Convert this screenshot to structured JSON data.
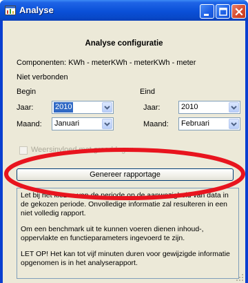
{
  "window": {
    "title": "Analyse"
  },
  "heading": "Analyse configuratie",
  "components_line": "Componenten: KWh - meterKWh - meterKWh - meter",
  "connection_status": "Niet verbonden",
  "begin": {
    "label": "Begin",
    "year_label": "Jaar:",
    "year_value": "2010",
    "month_label": "Maand:",
    "month_value": "Januari"
  },
  "end": {
    "label": "Eind",
    "year_label": "Jaar:",
    "year_value": "2010",
    "month_label": "Maand:",
    "month_value": "Februari"
  },
  "checkbox": {
    "label": "Weersinvloed met graaddagen",
    "checked": false,
    "enabled": false
  },
  "generate_button": "Genereer rapportage",
  "info": {
    "p1": "Let bij het kiezen van de periode op de aanwezigheid van data in de gekozen periode. Onvolledige informatie zal resulteren in een niet volledig rapport.",
    "p2": "Om een benchmark uit te kunnen voeren dienen inhoud-, oppervlakte en functieparameters ingevoerd te zijn.",
    "p3": "LET OP! Het kan tot vijf minuten duren voor gewijzigde informatie opgenomen is in het analyserapport."
  },
  "colors": {
    "titlebar": "#0a50d8",
    "client_bg": "#ece9d8",
    "selection": "#316ac5",
    "annotation": "#e8141e"
  },
  "icons": [
    "app-icon",
    "minimize-icon",
    "maximize-icon",
    "close-icon",
    "dropdown-arrow-icon",
    "resize-grip-icon"
  ]
}
